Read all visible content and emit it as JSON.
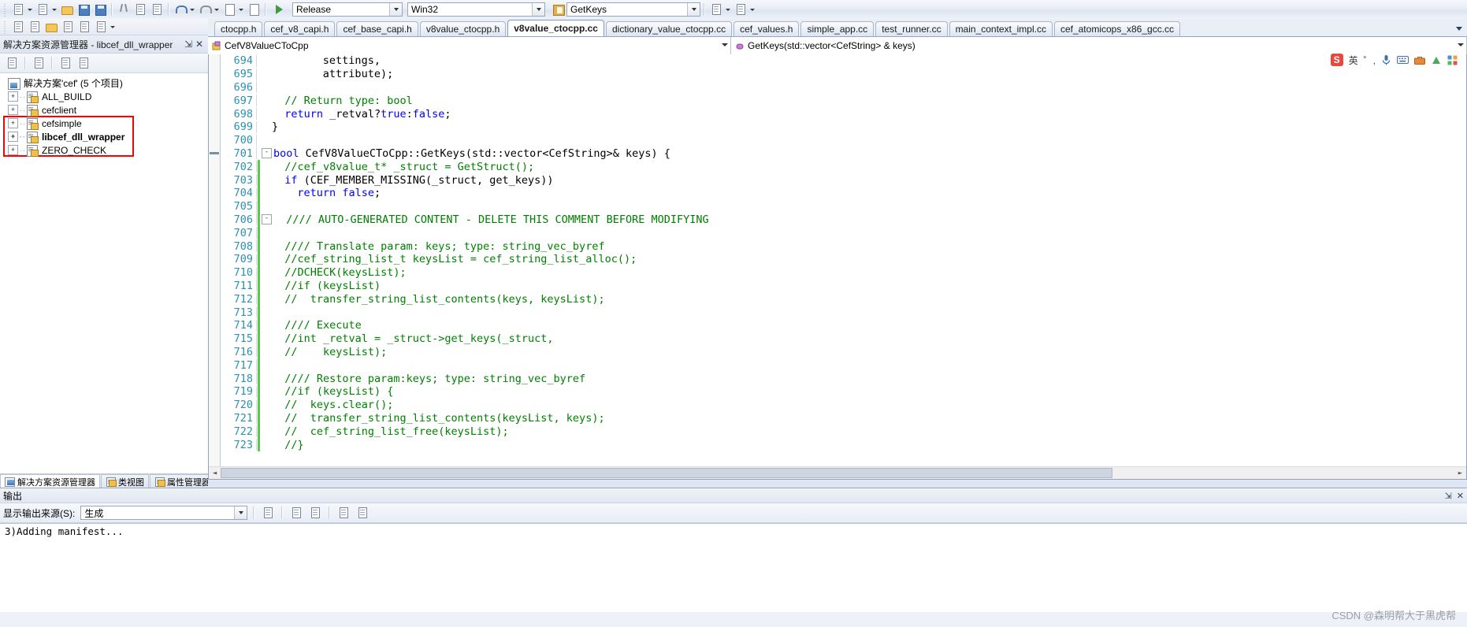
{
  "toolbar": {
    "icons": [
      {
        "name": "new-project-icon",
        "glyph": "page"
      },
      {
        "name": "new-item-icon",
        "glyph": "page2"
      },
      {
        "name": "open-file-icon",
        "glyph": "folder"
      },
      {
        "name": "save-icon",
        "glyph": "disk"
      },
      {
        "name": "save-all-icon",
        "glyph": "disk2"
      },
      {
        "name": "cut-icon",
        "glyph": "scissors"
      },
      {
        "name": "copy-icon",
        "glyph": "copy"
      },
      {
        "name": "paste-icon",
        "glyph": "paste"
      },
      {
        "name": "undo-icon",
        "glyph": "undo"
      },
      {
        "name": "redo-icon",
        "glyph": "redo"
      },
      {
        "name": "navigate-backward-icon",
        "glyph": "navback"
      },
      {
        "name": "navigate-forward-icon",
        "glyph": "navfwd"
      }
    ],
    "start_label": "",
    "configuration": "Release",
    "platform": "Win32",
    "target": "GetKeys"
  },
  "solution_explorer": {
    "title": "解决方案资源管理器 - libcef_dll_wrapper",
    "pin_glyph": "⇲",
    "close_glyph": "✕",
    "root": "解决方案'cef' (5 个项目)",
    "projects": [
      {
        "label": "ALL_BUILD",
        "bold": false,
        "highlighted": false
      },
      {
        "label": "cefclient",
        "bold": false,
        "highlighted": true
      },
      {
        "label": "cefsimple",
        "bold": false,
        "highlighted": true
      },
      {
        "label": "libcef_dll_wrapper",
        "bold": true,
        "highlighted": true
      },
      {
        "label": "ZERO_CHECK",
        "bold": false,
        "highlighted": false
      }
    ],
    "highlight_color": "#ff0000",
    "bottom_tabs": [
      {
        "label": "解决方案资源管理器",
        "active": true
      },
      {
        "label": "类视图",
        "active": false
      },
      {
        "label": "属性管理器",
        "active": false
      }
    ]
  },
  "editor": {
    "tabs": [
      {
        "label": "ctocpp.h",
        "active": false
      },
      {
        "label": "cef_v8_capi.h",
        "active": false
      },
      {
        "label": "cef_base_capi.h",
        "active": false
      },
      {
        "label": "v8value_ctocpp.h",
        "active": false
      },
      {
        "label": "v8value_ctocpp.cc",
        "active": true
      },
      {
        "label": "dictionary_value_ctocpp.cc",
        "active": false
      },
      {
        "label": "cef_values.h",
        "active": false
      },
      {
        "label": "simple_app.cc",
        "active": false
      },
      {
        "label": "test_runner.cc",
        "active": false
      },
      {
        "label": "main_context_impl.cc",
        "active": false
      },
      {
        "label": "cef_atomicops_x86_gcc.cc",
        "active": false
      }
    ],
    "nav_class": "CefV8ValueCToCpp",
    "nav_member": "GetKeys(std::vector<CefString> & keys)",
    "first_line_number": 694,
    "lines": [
      {
        "n": 694,
        "fold": "",
        "mod": false,
        "indent": 8,
        "tokens": [
          {
            "t": "settings,",
            "c": "src"
          }
        ]
      },
      {
        "n": 695,
        "fold": "",
        "mod": false,
        "indent": 8,
        "tokens": [
          {
            "t": "attribute);",
            "c": "src"
          }
        ]
      },
      {
        "n": 696,
        "fold": "",
        "mod": false,
        "indent": 0,
        "tokens": []
      },
      {
        "n": 697,
        "fold": "",
        "mod": false,
        "indent": 2,
        "tokens": [
          {
            "t": "// Return type: bool",
            "c": "cm"
          }
        ]
      },
      {
        "n": 698,
        "fold": "",
        "mod": false,
        "indent": 2,
        "tokens": [
          {
            "t": "return",
            "c": "kw"
          },
          {
            "t": " _retval?",
            "c": "src"
          },
          {
            "t": "true",
            "c": "kw"
          },
          {
            "t": ":",
            "c": "src"
          },
          {
            "t": "false",
            "c": "kw"
          },
          {
            "t": ";",
            "c": "src"
          }
        ]
      },
      {
        "n": 699,
        "fold": "",
        "mod": false,
        "indent": 0,
        "tokens": [
          {
            "t": "}",
            "c": "src"
          }
        ]
      },
      {
        "n": 700,
        "fold": "",
        "mod": false,
        "indent": 0,
        "tokens": []
      },
      {
        "n": 701,
        "fold": "-",
        "mod": false,
        "indent": 0,
        "marker": true,
        "tokens": [
          {
            "t": "bool",
            "c": "kw"
          },
          {
            "t": " CefV8ValueCToCpp::GetKeys(std::vector<CefString>& keys) {",
            "c": "src"
          }
        ]
      },
      {
        "n": 702,
        "fold": "",
        "mod": true,
        "indent": 2,
        "tokens": [
          {
            "t": "//cef_v8value_t* _struct = GetStruct();",
            "c": "cm"
          }
        ]
      },
      {
        "n": 703,
        "fold": "",
        "mod": true,
        "indent": 2,
        "tokens": [
          {
            "t": "if",
            "c": "kw"
          },
          {
            "t": " (CEF_MEMBER_MISSING(_struct, get_keys))",
            "c": "src"
          }
        ]
      },
      {
        "n": 704,
        "fold": "",
        "mod": true,
        "indent": 4,
        "tokens": [
          {
            "t": "return",
            "c": "kw"
          },
          {
            "t": " ",
            "c": "src"
          },
          {
            "t": "false",
            "c": "kw"
          },
          {
            "t": ";",
            "c": "src"
          }
        ]
      },
      {
        "n": 705,
        "fold": "",
        "mod": true,
        "indent": 0,
        "tokens": []
      },
      {
        "n": 706,
        "fold": "-",
        "mod": true,
        "indent": 2,
        "tokens": [
          {
            "t": "//// AUTO-GENERATED CONTENT - DELETE THIS COMMENT BEFORE MODIFYING",
            "c": "cm"
          }
        ]
      },
      {
        "n": 707,
        "fold": "",
        "mod": true,
        "indent": 0,
        "tokens": []
      },
      {
        "n": 708,
        "fold": "",
        "mod": true,
        "indent": 2,
        "tokens": [
          {
            "t": "//// Translate param: keys; type: string_vec_byref",
            "c": "cm"
          }
        ]
      },
      {
        "n": 709,
        "fold": "",
        "mod": true,
        "indent": 2,
        "tokens": [
          {
            "t": "//cef_string_list_t keysList = cef_string_list_alloc();",
            "c": "cm"
          }
        ]
      },
      {
        "n": 710,
        "fold": "",
        "mod": true,
        "indent": 2,
        "tokens": [
          {
            "t": "//DCHECK(keysList);",
            "c": "cm"
          }
        ]
      },
      {
        "n": 711,
        "fold": "",
        "mod": true,
        "indent": 2,
        "tokens": [
          {
            "t": "//if (keysList)",
            "c": "cm"
          }
        ]
      },
      {
        "n": 712,
        "fold": "",
        "mod": true,
        "indent": 2,
        "tokens": [
          {
            "t": "//  transfer_string_list_contents(keys, keysList);",
            "c": "cm"
          }
        ]
      },
      {
        "n": 713,
        "fold": "",
        "mod": true,
        "indent": 0,
        "tokens": []
      },
      {
        "n": 714,
        "fold": "",
        "mod": true,
        "indent": 2,
        "tokens": [
          {
            "t": "//// Execute",
            "c": "cm"
          }
        ]
      },
      {
        "n": 715,
        "fold": "",
        "mod": true,
        "indent": 2,
        "tokens": [
          {
            "t": "//int _retval = _struct->get_keys(_struct,",
            "c": "cm"
          }
        ]
      },
      {
        "n": 716,
        "fold": "",
        "mod": true,
        "indent": 2,
        "tokens": [
          {
            "t": "//    keysList);",
            "c": "cm"
          }
        ]
      },
      {
        "n": 717,
        "fold": "",
        "mod": true,
        "indent": 0,
        "tokens": []
      },
      {
        "n": 718,
        "fold": "",
        "mod": true,
        "indent": 2,
        "tokens": [
          {
            "t": "//// Restore param:keys; type: string_vec_byref",
            "c": "cm"
          }
        ]
      },
      {
        "n": 719,
        "fold": "",
        "mod": true,
        "indent": 2,
        "tokens": [
          {
            "t": "//if (keysList) {",
            "c": "cm"
          }
        ]
      },
      {
        "n": 720,
        "fold": "",
        "mod": true,
        "indent": 2,
        "tokens": [
          {
            "t": "//  keys.clear();",
            "c": "cm"
          }
        ]
      },
      {
        "n": 721,
        "fold": "",
        "mod": true,
        "indent": 2,
        "tokens": [
          {
            "t": "//  transfer_string_list_contents(keysList, keys);",
            "c": "cm"
          }
        ]
      },
      {
        "n": 722,
        "fold": "",
        "mod": true,
        "indent": 2,
        "tokens": [
          {
            "t": "//  cef_string_list_free(keysList);",
            "c": "cm"
          }
        ]
      },
      {
        "n": 723,
        "fold": "",
        "mod": true,
        "indent": 2,
        "tokens": [
          {
            "t": "//}",
            "c": "cm"
          }
        ]
      }
    ]
  },
  "ime": {
    "logo": "S",
    "lang": "英",
    "punct": "゜,",
    "items": [
      "mic-icon",
      "keyboard-icon",
      "toolbox-icon",
      "skin-icon",
      "apps-icon"
    ]
  },
  "output": {
    "title": "输出",
    "auto_hide_glyph": "⇲",
    "close_glyph": "✕",
    "source_label": "显示输出来源(S):",
    "source_value": "生成",
    "lines": [
      "3)Adding manifest..."
    ]
  },
  "watermark": "CSDN @森明帮大于黑虎帮"
}
